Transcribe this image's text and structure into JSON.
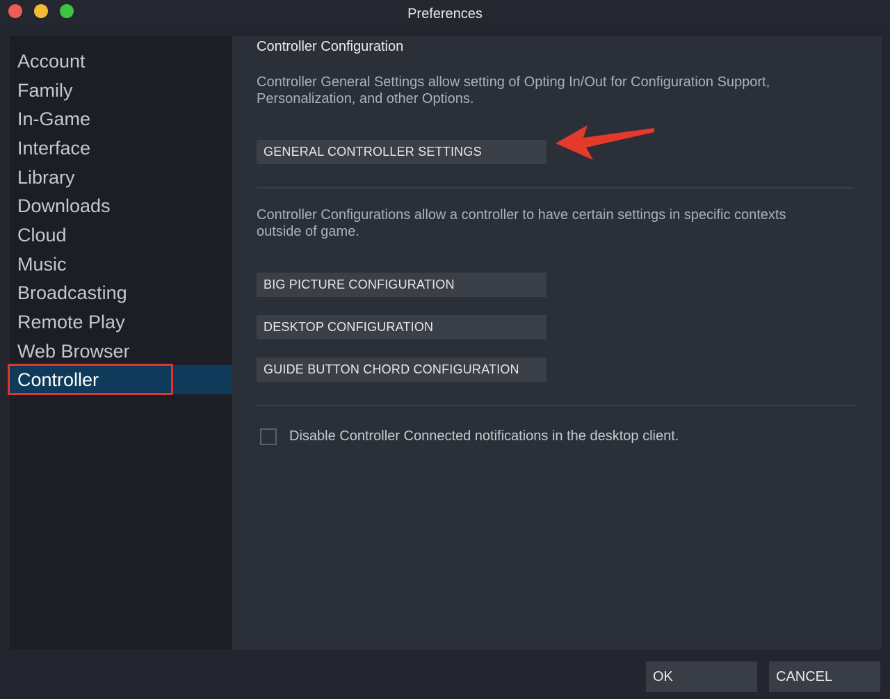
{
  "window": {
    "title": "Preferences"
  },
  "sidebar": {
    "items": [
      {
        "label": "Account"
      },
      {
        "label": "Family"
      },
      {
        "label": "In-Game"
      },
      {
        "label": "Interface"
      },
      {
        "label": "Library"
      },
      {
        "label": "Downloads"
      },
      {
        "label": "Cloud"
      },
      {
        "label": "Music"
      },
      {
        "label": "Broadcasting"
      },
      {
        "label": "Remote Play"
      },
      {
        "label": "Web Browser"
      },
      {
        "label": "Controller"
      }
    ],
    "selected": "Controller"
  },
  "main": {
    "title": "Controller Configuration",
    "general_desc": "Controller General Settings allow setting of Opting In/Out for Configuration Support, Personalization, and other Options.",
    "general_button": "GENERAL CONTROLLER SETTINGS",
    "configs_desc": "Controller Configurations allow a controller to have certain settings in specific contexts outside of game.",
    "buttons": [
      {
        "label": "BIG PICTURE CONFIGURATION"
      },
      {
        "label": "DESKTOP CONFIGURATION"
      },
      {
        "label": "GUIDE BUTTON CHORD CONFIGURATION"
      }
    ],
    "checkbox_label": "Disable Controller Connected notifications in the desktop client.",
    "checkbox_checked": false
  },
  "footer": {
    "ok_label": "OK",
    "cancel_label": "CANCEL"
  },
  "colors": {
    "selected_bg": "#0f3a5a",
    "annotation_red": "#e0362b"
  }
}
